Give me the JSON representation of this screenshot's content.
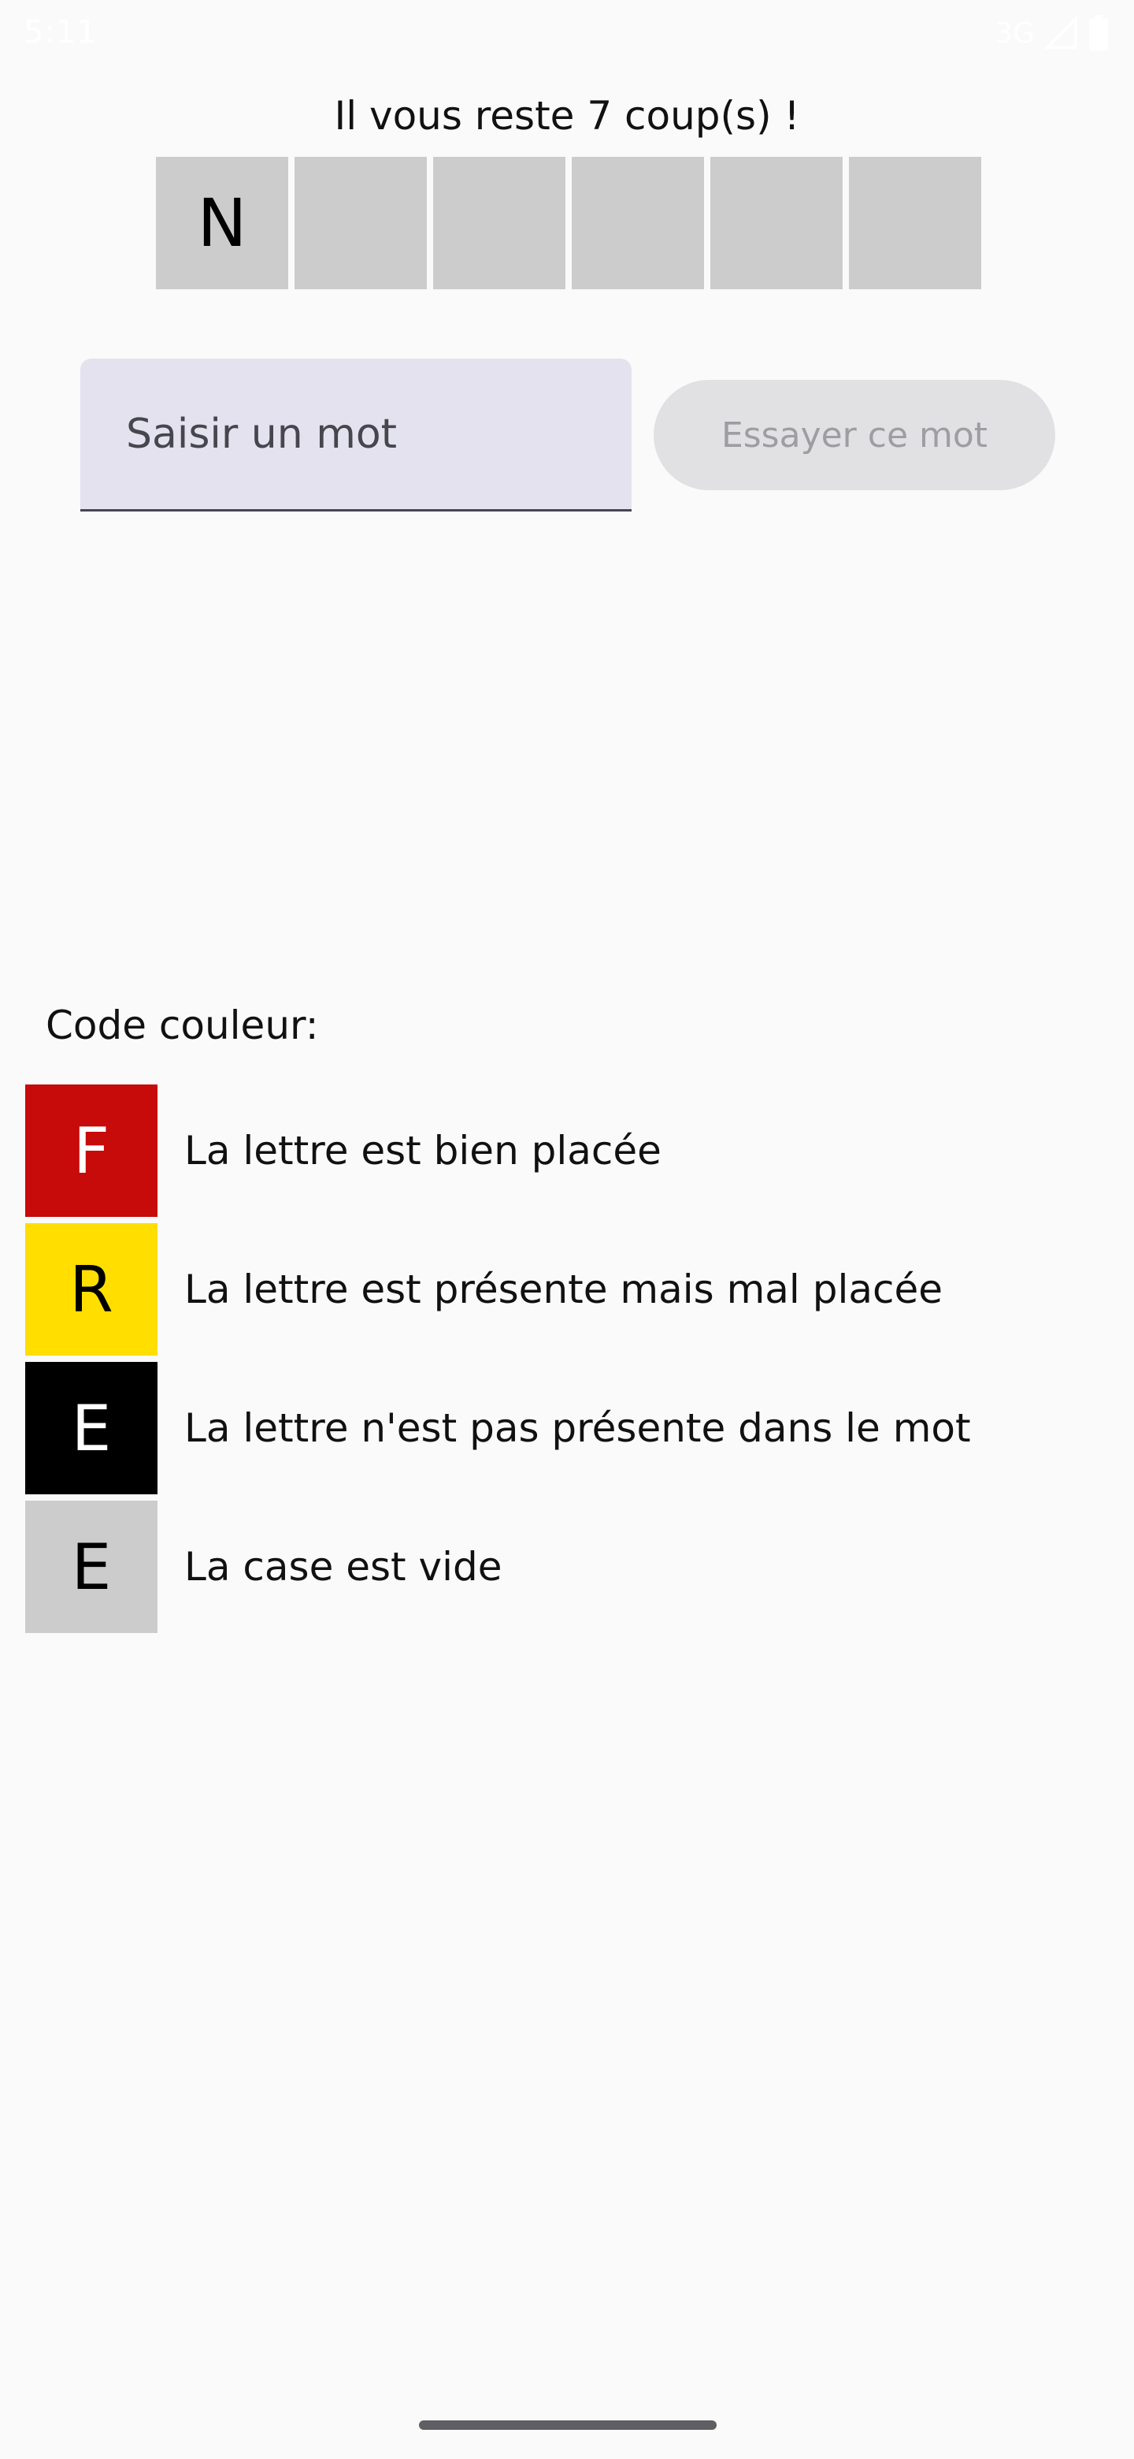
{
  "status_bar": {
    "time": "5:11",
    "network": "3G",
    "icons": [
      "cellular-signal-icon",
      "battery-icon"
    ]
  },
  "game": {
    "tries_text": "Il vous reste 7 coup(s) !",
    "cells": [
      "N",
      "",
      "",
      "",
      "",
      ""
    ]
  },
  "input": {
    "value": "",
    "placeholder": "Saisir un mot"
  },
  "try_button": {
    "label": "Essayer ce mot",
    "enabled": false
  },
  "legend": {
    "title": "Code couleur:",
    "items": [
      {
        "letter": "F",
        "color": "#c70a0a",
        "text_color": "#ffffff",
        "label": "La lettre est bien placée"
      },
      {
        "letter": "R",
        "color": "#ffde00",
        "text_color": "#000000",
        "label": "La lettre est présente mais mal placée"
      },
      {
        "letter": "E",
        "color": "#000000",
        "text_color": "#ffffff",
        "label": "La lettre n'est pas présente dans le mot"
      },
      {
        "letter": "E",
        "color": "#cccccc",
        "text_color": "#000000",
        "label": "La case est vide"
      }
    ]
  },
  "colors": {
    "background": "#fafafa",
    "empty_cell": "#cccccc",
    "input_fill": "#e3e2ee",
    "button_disabled": "#e1e1e3"
  }
}
